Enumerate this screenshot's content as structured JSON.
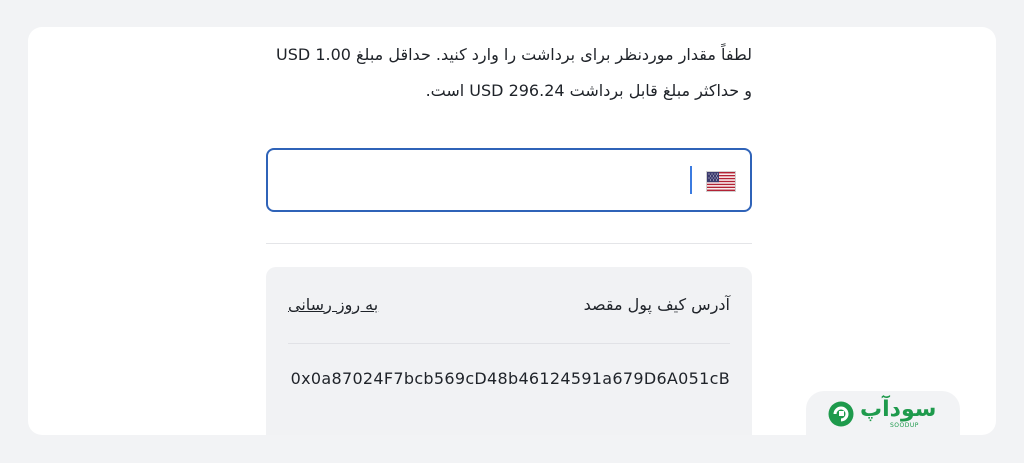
{
  "withdraw": {
    "instructions": "لطفاً مقدار موردنظر برای برداشت را وارد کنید. حداقل مبلغ USD 1.00 و حداکثر مبلغ قابل برداشت USD 296.24 است.",
    "amount_value": "",
    "currency_icon": "us-flag-icon"
  },
  "wallet": {
    "label": "آدرس کیف پول مقصد",
    "update_link": "به روز رسانی",
    "address": "0x0a87024F7bcb569cD48b46124591a679D6A051cB"
  },
  "watermark": {
    "logo_text": "سودآپ",
    "logo_sub": "SOODUP"
  },
  "colors": {
    "accent": "#2f63b8",
    "brand": "#1e9a4c"
  }
}
